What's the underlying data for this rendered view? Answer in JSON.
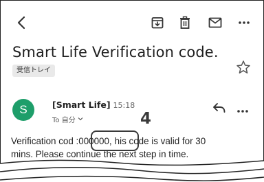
{
  "email": {
    "subject": "Smart Life Verification code.",
    "label": "受信トレイ",
    "sender": "[Smart Life]",
    "time": "15:18",
    "avatar_letter": "S",
    "to_line": "To 自分",
    "body_line1": "Verification cod :000000,",
    "body_line1_rest": "his code is valid for 30",
    "body_line2": "mins. Please continue the next step in time."
  },
  "annotation": {
    "step_number": "4"
  },
  "icons": {
    "toolbar": [
      "back-arrow-icon",
      "archive-icon",
      "trash-icon",
      "mail-icon",
      "more-icon"
    ],
    "message": [
      "reply-icon",
      "more-icon"
    ],
    "star": "star-icon"
  },
  "colors": {
    "avatar": "#1e9e6a",
    "label_chip": "#e9e9e9",
    "highlight_border": "#3a3a3a"
  }
}
